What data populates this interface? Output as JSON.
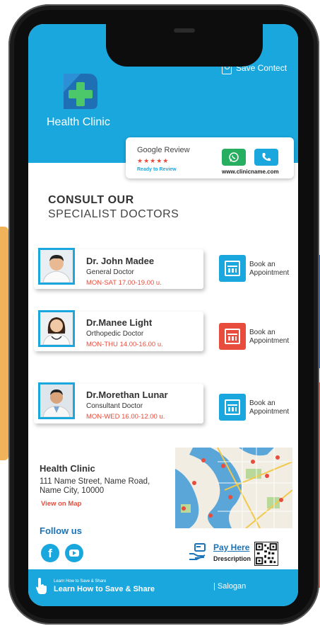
{
  "header": {
    "clinic_name": "Health Clinic",
    "save_contact_label": "Save Contect"
  },
  "review": {
    "title": "Google Review",
    "stars": "★★★★★",
    "ready_label": "Ready to Review",
    "website": "www.clinicname.com"
  },
  "consult": {
    "line1": "CONSULT OUR",
    "line2": "SPECIALIST DOCTORS"
  },
  "doctors": [
    {
      "name": "Dr. John Madee",
      "role": "General Doctor",
      "time": "MON-SAT 17.00-19.00 u.",
      "book_line1": "Book an",
      "book_line2": "Appointment",
      "book_color": "#1aa7dd"
    },
    {
      "name": "Dr.Manee Light",
      "role": "Orthopedic Doctor",
      "time": "MON-THU 14.00-16.00 u.",
      "book_line1": "Book an",
      "book_line2": "Appointment",
      "book_color": "#e74c3c"
    },
    {
      "name": "Dr.Morethan Lunar",
      "role": "Consultant Doctor",
      "time": "MON-WED 16.00-12.00 u.",
      "book_line1": "Book an",
      "book_line2": "Appointment",
      "book_color": "#1aa7dd"
    }
  ],
  "address": {
    "title": "Health Clinic",
    "text": "111  Name Street, Name Road, Name City, 10000",
    "map_link": "View on Map"
  },
  "social": {
    "follow_label": "Follow us",
    "facebook_glyph": "f"
  },
  "payment": {
    "pay_label": "Pay Here",
    "desc_label": "Drescription"
  },
  "footer": {
    "learn_small": "Learn How to Save & Share",
    "learn": "Learn How to Save & Share",
    "slogan": "| Salogan"
  },
  "colors": {
    "primary": "#1aa7dd",
    "accent_red": "#e74c3c",
    "whatsapp_green": "#27ae60"
  }
}
